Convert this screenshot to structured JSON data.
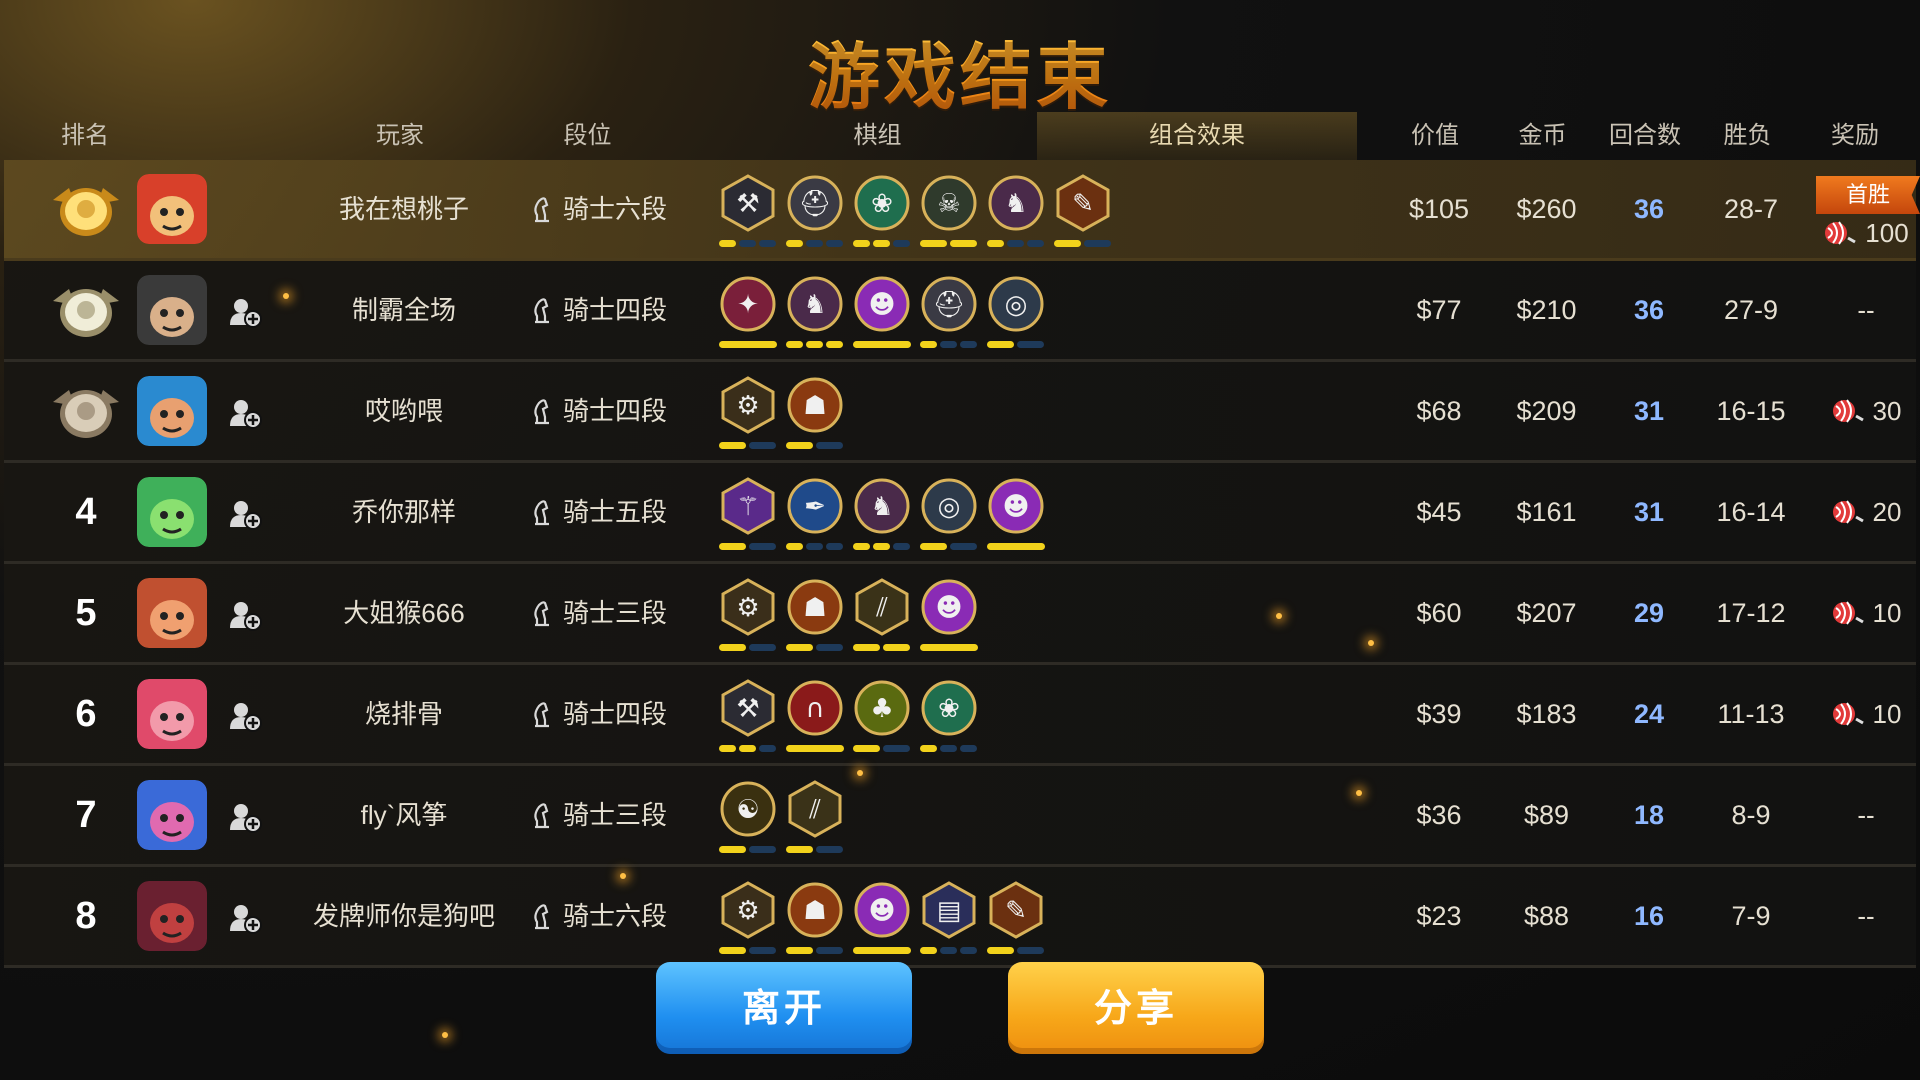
{
  "title": "游戏结束",
  "headers": {
    "rank": "排名",
    "player": "玩家",
    "tier": "段位",
    "deck": "棋组",
    "synergy": "组合效果",
    "value": "价值",
    "gold": "金币",
    "rounds": "回合数",
    "winloss": "胜负",
    "reward": "奖励"
  },
  "colors": {
    "accent_gold": "#f2d21b",
    "rounds_blue": "#8fb8ff",
    "leave_blue": "#1f8ff0",
    "share_orange": "#f7a719"
  },
  "first_win_label": "首胜",
  "players": [
    {
      "rank": "",
      "medal": "gold-medal",
      "name": "我在想桃子",
      "tier": "骑士六段",
      "value": "$105",
      "gold": "$260",
      "rounds": "36",
      "wl": "28-7",
      "reward": "100",
      "traits": [
        "axe-hex-icon",
        "helmet-icon",
        "paw-icon",
        "skull-icon",
        "knight-icon",
        "feather-hex-icon"
      ],
      "bars": [
        [
          1,
          0,
          0
        ],
        [
          1,
          0,
          0
        ],
        [
          1,
          1,
          0
        ],
        [
          1,
          1
        ],
        [
          1,
          0,
          0
        ],
        [
          1,
          0
        ]
      ]
    },
    {
      "rank": "",
      "medal": "silver-medal",
      "name": "制霸全场",
      "tier": "骑士四段",
      "value": "$77",
      "gold": "$210",
      "rounds": "36",
      "wl": "27-9",
      "reward": "--",
      "traits": [
        "demon-wing-icon",
        "knight-icon",
        "imp-icon",
        "helmet-icon",
        "orbs-icon"
      ],
      "bars": [
        [
          1
        ],
        [
          1,
          1,
          1
        ],
        [
          1
        ],
        [
          1,
          0,
          0
        ],
        [
          1,
          0
        ]
      ]
    },
    {
      "rank": "",
      "medal": "bronze-medal",
      "name": "哎哟喂",
      "tier": "骑士四段",
      "value": "$68",
      "gold": "$209",
      "rounds": "31",
      "wl": "16-15",
      "reward": "30",
      "traits": [
        "gear-hex-icon",
        "goblin-icon"
      ],
      "bars": [
        [
          1,
          0
        ],
        [
          1,
          0
        ]
      ]
    },
    {
      "rank": "4",
      "medal": "",
      "name": "乔你那样",
      "tier": "骑士五段",
      "value": "$45",
      "gold": "$161",
      "rounds": "31",
      "wl": "16-14",
      "reward": "20",
      "traits": [
        "wizard-hex-icon",
        "feather-icon",
        "knight-icon",
        "orbs-icon",
        "imp-icon"
      ],
      "bars": [
        [
          1,
          0
        ],
        [
          1,
          0,
          0
        ],
        [
          1,
          1,
          0
        ],
        [
          1,
          0
        ],
        [
          1
        ]
      ]
    },
    {
      "rank": "5",
      "medal": "",
      "name": "大姐猴666",
      "tier": "骑士三段",
      "value": "$60",
      "gold": "$207",
      "rounds": "29",
      "wl": "17-12",
      "reward": "10",
      "traits": [
        "gear-hex-icon",
        "goblin-icon",
        "claw-hex-icon",
        "imp-icon"
      ],
      "bars": [
        [
          1,
          0
        ],
        [
          1,
          0
        ],
        [
          1,
          1
        ],
        [
          1
        ]
      ]
    },
    {
      "rank": "6",
      "medal": "",
      "name": "烧排骨",
      "tier": "骑士四段",
      "value": "$39",
      "gold": "$183",
      "rounds": "24",
      "wl": "11-13",
      "reward": "10",
      "traits": [
        "axe-hex-icon",
        "arch-icon",
        "tree-icon",
        "paw-icon"
      ],
      "bars": [
        [
          1,
          1,
          0
        ],
        [
          1
        ],
        [
          1,
          0
        ],
        [
          1,
          0,
          0
        ]
      ]
    },
    {
      "rank": "7",
      "medal": "",
      "name": "fly`风筝",
      "tier": "骑士三段",
      "value": "$36",
      "gold": "$89",
      "rounds": "18",
      "wl": "8-9",
      "reward": "--",
      "traits": [
        "yinyang-icon",
        "claw-hex-icon"
      ],
      "bars": [
        [
          1,
          0
        ],
        [
          1,
          0
        ]
      ]
    },
    {
      "rank": "8",
      "medal": "",
      "name": "发牌师你是狗吧",
      "tier": "骑士六段",
      "value": "$23",
      "gold": "$88",
      "rounds": "16",
      "wl": "7-9",
      "reward": "--",
      "traits": [
        "gear-hex-icon",
        "goblin-icon",
        "imp-icon",
        "scroll-hex-icon",
        "feather-hex-icon"
      ],
      "bars": [
        [
          1,
          0
        ],
        [
          1,
          0
        ],
        [
          1
        ],
        [
          1,
          0,
          0
        ],
        [
          1,
          0
        ]
      ]
    }
  ],
  "buttons": {
    "leave": "离开",
    "share": "分享"
  }
}
